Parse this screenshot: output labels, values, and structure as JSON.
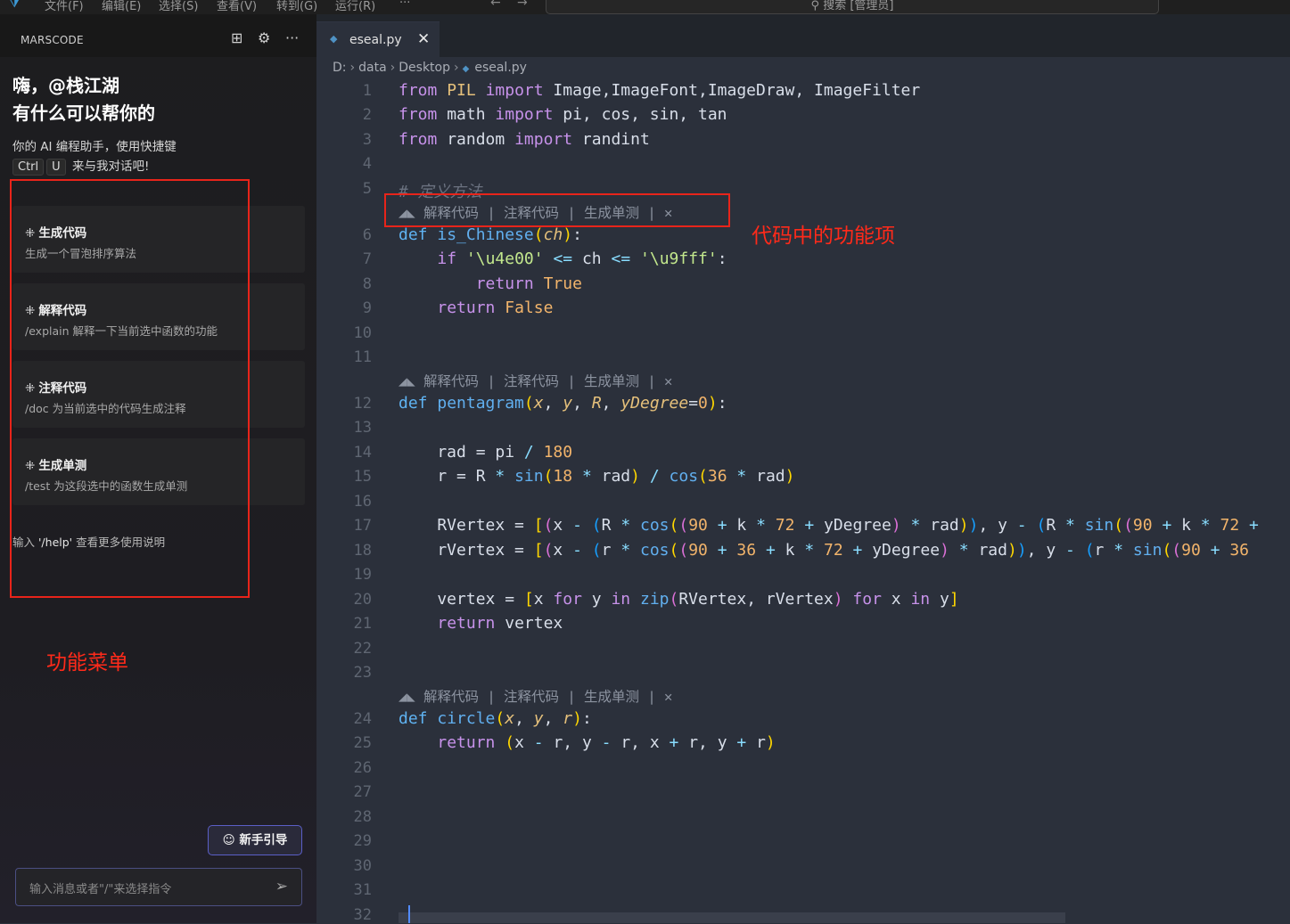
{
  "menubar": {
    "items": [
      "文件(F)",
      "编辑(E)",
      "选择(S)",
      "查看(V)",
      "转到(G)",
      "运行(R)",
      "···"
    ],
    "search": "搜索 [管理员]"
  },
  "sidebar": {
    "title": "MARSCODE",
    "greeting_line1": "嗨，@栈江湖",
    "greeting_line2": "有什么可以帮你的",
    "intro_text": "你的 AI 编程助手，使用快捷键",
    "key1": "Ctrl",
    "key2": "U",
    "intro_tail": "来与我对话吧!",
    "cards": [
      {
        "title": "生成代码",
        "desc": "生成一个冒泡排序算法"
      },
      {
        "title": "解释代码",
        "desc": "/explain 解释一下当前选中函数的功能"
      },
      {
        "title": "注释代码",
        "desc": "/doc 为当前选中的代码生成注释"
      },
      {
        "title": "生成单测",
        "desc": "/test 为这段选中的函数生成单测"
      }
    ],
    "help_prefix": "输入",
    "help_cmd": "'/help'",
    "help_suffix": "查看更多使用说明",
    "annotation": "功能菜单",
    "guide_button": "新手引导",
    "chat_placeholder": "输入消息或者\"/\"来选择指令"
  },
  "editor": {
    "tab_name": "eseal.py",
    "breadcrumb": [
      "D:",
      "data",
      "Desktop",
      "eseal.py"
    ],
    "lens_text": "解释代码 | 注释代码 | 生成单测 | ✕",
    "annotation": "代码中的功能项",
    "line_numbers": [
      "1",
      "2",
      "3",
      "4",
      "5",
      "6",
      "7",
      "8",
      "9",
      "10",
      "11",
      "12",
      "13",
      "14",
      "15",
      "16",
      "17",
      "18",
      "19",
      "20",
      "21",
      "22",
      "23",
      "24",
      "25",
      "26",
      "27",
      "28",
      "29",
      "30",
      "31",
      "32"
    ]
  },
  "colors": {
    "annotation_red": "#e8241a",
    "keyword": "#c792ea",
    "function": "#61afef",
    "number": "#f2b46b",
    "string": "#c3e88d"
  }
}
